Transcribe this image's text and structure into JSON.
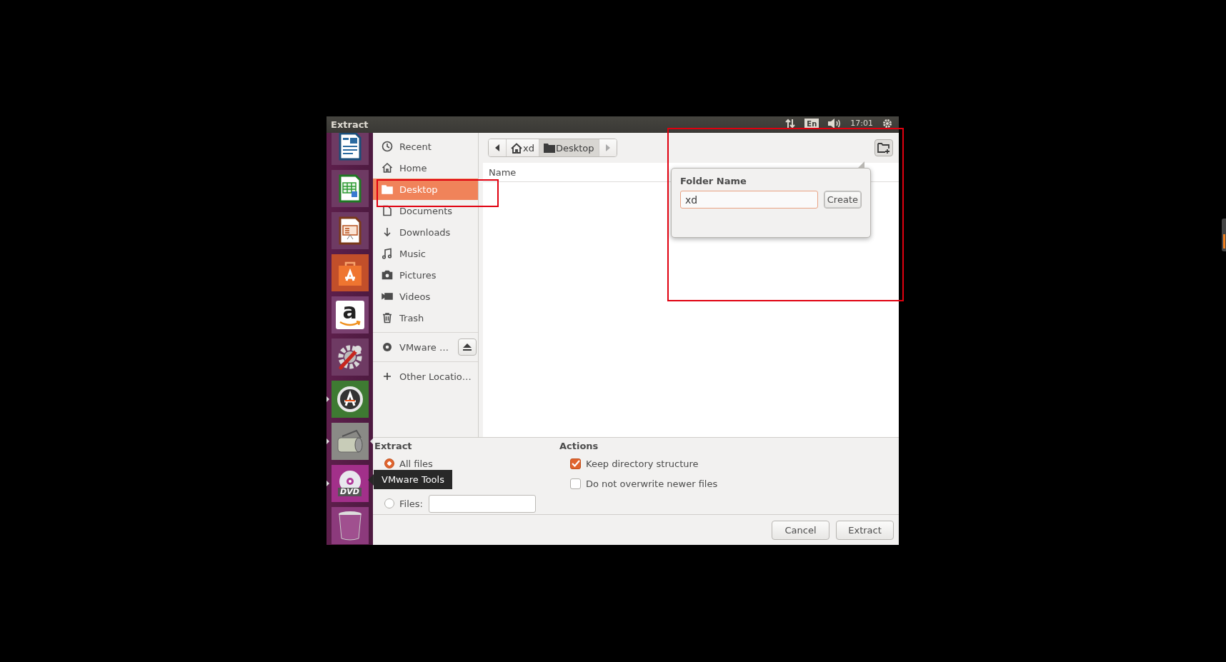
{
  "window": {
    "title": "Extract"
  },
  "panel": {
    "keyboard": "En",
    "time": "17:01"
  },
  "launcher": {
    "items": [
      {
        "kind": "writer",
        "running": false,
        "focused": false
      },
      {
        "kind": "calc",
        "running": false,
        "focused": false
      },
      {
        "kind": "impress",
        "running": false,
        "focused": false
      },
      {
        "kind": "store",
        "running": false,
        "focused": false
      },
      {
        "kind": "amazon",
        "glyph": "a",
        "running": false,
        "focused": false
      },
      {
        "kind": "settings",
        "running": false,
        "focused": false
      },
      {
        "kind": "updater",
        "running": true,
        "focused": false
      },
      {
        "kind": "roller",
        "running": true,
        "focused": true
      },
      {
        "kind": "dvd",
        "glyph": "DVD",
        "running": true,
        "focused": false
      },
      {
        "kind": "trash",
        "running": false,
        "focused": false
      }
    ],
    "tooltip": "VMware Tools"
  },
  "places": [
    {
      "kind": "recent",
      "label": "Recent",
      "selected": false
    },
    {
      "kind": "home",
      "label": "Home",
      "selected": false
    },
    {
      "kind": "folder",
      "label": "Desktop",
      "selected": true
    },
    {
      "kind": "document",
      "label": "Documents",
      "selected": false
    },
    {
      "kind": "download",
      "label": "Downloads",
      "selected": false
    },
    {
      "kind": "music",
      "label": "Music",
      "selected": false
    },
    {
      "kind": "camera",
      "label": "Pictures",
      "selected": false
    },
    {
      "kind": "video",
      "label": "Videos",
      "selected": false
    },
    {
      "kind": "trash",
      "label": "Trash",
      "selected": false
    }
  ],
  "devices": [
    {
      "label": "VMware …"
    }
  ],
  "other_locations": {
    "label": "Other Locatio…"
  },
  "path_bar": {
    "segments": [
      {
        "kind": "home",
        "label": "xd",
        "selected": false
      },
      {
        "kind": "folder",
        "label": "Desktop",
        "selected": true
      }
    ]
  },
  "file_list": {
    "columns": [
      "Name"
    ]
  },
  "new_folder_popover": {
    "title": "Folder Name",
    "value": "xd",
    "button": "Create"
  },
  "extract_options": {
    "title": "Extract",
    "options": [
      {
        "kind": "plain",
        "label": "All files",
        "selected": true
      },
      {
        "kind": "with_field",
        "label": "Files:",
        "selected": false
      }
    ]
  },
  "actions": {
    "title": "Actions",
    "options": [
      {
        "label": "Keep directory structure",
        "checked": true
      },
      {
        "label": "Do not overwrite newer files",
        "checked": false
      }
    ]
  },
  "buttons": [
    {
      "label": "Cancel"
    },
    {
      "label": "Extract"
    }
  ]
}
